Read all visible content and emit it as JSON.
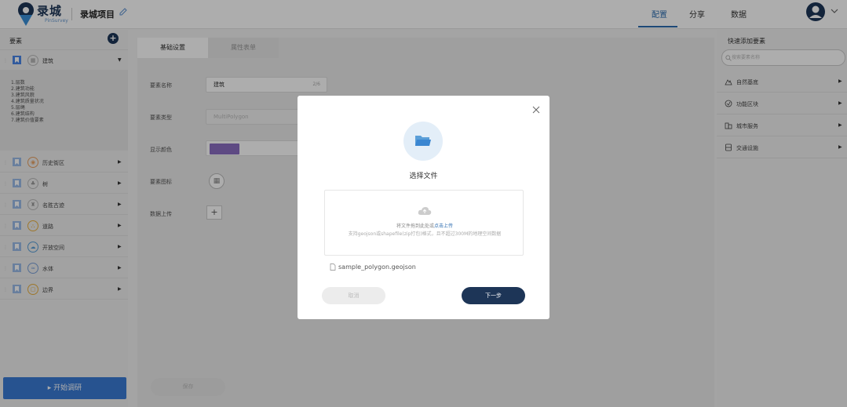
{
  "header": {
    "logo_text": "录城",
    "logo_sub": "PinSurvey",
    "project_title": "录城项目",
    "nav": [
      "配置",
      "分享",
      "数据"
    ],
    "active_nav": "配置"
  },
  "left": {
    "title": "要素",
    "items": [
      {
        "label": "建筑",
        "icon": "building-icon"
      },
      {
        "label": "历史街区",
        "icon": "history-icon"
      },
      {
        "label": "树",
        "icon": "tree-icon"
      },
      {
        "label": "名胜古迹",
        "icon": "landmark-icon"
      },
      {
        "label": "道路",
        "icon": "road-icon"
      },
      {
        "label": "开放空间",
        "icon": "park-icon"
      },
      {
        "label": "水体",
        "icon": "water-icon"
      },
      {
        "label": "边界",
        "icon": "boundary-icon"
      }
    ],
    "attributes": [
      "1.层数",
      "2.建筑功能",
      "3.建筑风貌",
      "4.建筑质量状况",
      "5.层绳",
      "6.建筑结构",
      "7.建筑价值要素"
    ],
    "start_button": "▸ 开始调研"
  },
  "middle": {
    "tabs": [
      "基础设置",
      "属性表单"
    ],
    "fields": {
      "name_label": "要素名称",
      "name_value": "建筑",
      "name_count": "2/6",
      "type_label": "要素类型",
      "type_value": "MultiPolygon",
      "color_label": "显示颜色",
      "icon_label": "要素图标",
      "upload_label": "数据上传"
    },
    "save_button": "保存"
  },
  "right": {
    "title": "快速添加要素",
    "search_placeholder": "搜索要素名称",
    "categories": [
      {
        "label": "自然基底",
        "icon": "nature-icon"
      },
      {
        "label": "功能区块",
        "icon": "function-icon"
      },
      {
        "label": "城市服务",
        "icon": "service-icon"
      },
      {
        "label": "交通设施",
        "icon": "transport-icon"
      }
    ]
  },
  "modal": {
    "title": "选择文件",
    "drop_text": "将文件拖到此处或",
    "drop_link": "点击上传",
    "drop_hint": "支持geojson或shapefile(zip打包)格式，且不超过300M的地理空间数据",
    "file_name": "sample_polygon.geojson",
    "cancel": "取消",
    "next": "下一步"
  },
  "colors": {
    "primary": "#1d3557",
    "accent": "#2b6cb0",
    "swatch": "#8b6ec2",
    "start": "#3a7bd5"
  }
}
